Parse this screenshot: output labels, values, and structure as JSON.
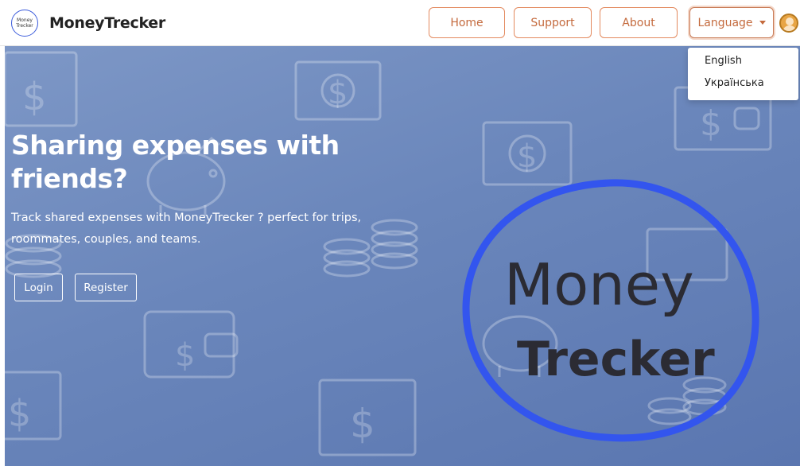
{
  "navbar": {
    "logo_line1": "Money",
    "logo_line2": "Trecker",
    "brand": "MoneyTrecker",
    "links": {
      "home": "Home",
      "support": "Support",
      "about": "About"
    },
    "language_label": "Language"
  },
  "language_menu": {
    "english": "English",
    "ukrainian": "Українська"
  },
  "hero": {
    "title": "Sharing expenses with friends?",
    "description": "Track shared expenses with MoneyTrecker ? perfect for trips, roommates, couples, and teams.",
    "login_label": "Login",
    "register_label": "Register",
    "logo_word1": "Money",
    "logo_word2": "Trecker"
  },
  "colors": {
    "accent_orange": "#e38a5f",
    "hero_background": "#6a86bb",
    "logo_ring": "#3355ee"
  },
  "icons": [
    "user-avatar-icon",
    "caret-down-icon",
    "dollar-bill-icon",
    "coin-stack-icon",
    "wallet-icon",
    "piggy-bank-icon"
  ]
}
